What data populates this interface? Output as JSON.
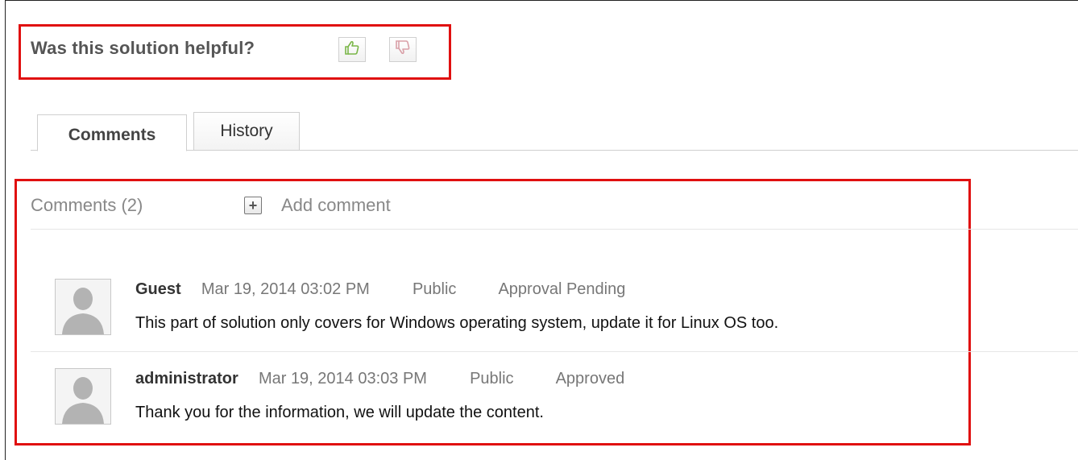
{
  "helpful": {
    "question": "Was this solution helpful?",
    "up_icon": "thumbs-up-icon",
    "down_icon": "thumbs-down-icon",
    "up_color": "#7ab648",
    "down_color": "#d9a0a8"
  },
  "tabs": [
    {
      "label": "Comments",
      "active": true
    },
    {
      "label": "History",
      "active": false
    }
  ],
  "comments_header": {
    "count_label": "Comments (2)",
    "add_label": "Add comment",
    "add_icon": "plus-icon"
  },
  "comments": [
    {
      "author": "Guest",
      "timestamp": "Mar 19, 2014 03:02 PM",
      "visibility": "Public",
      "status": "Approval Pending",
      "text": "This part of solution only covers for Windows operating system, update it for Linux OS too."
    },
    {
      "author": "administrator",
      "timestamp": "Mar 19, 2014 03:03 PM",
      "visibility": "Public",
      "status": "Approved",
      "text": "Thank you for the information, we will update the content."
    }
  ],
  "colors": {
    "highlight_border": "#e01010"
  }
}
